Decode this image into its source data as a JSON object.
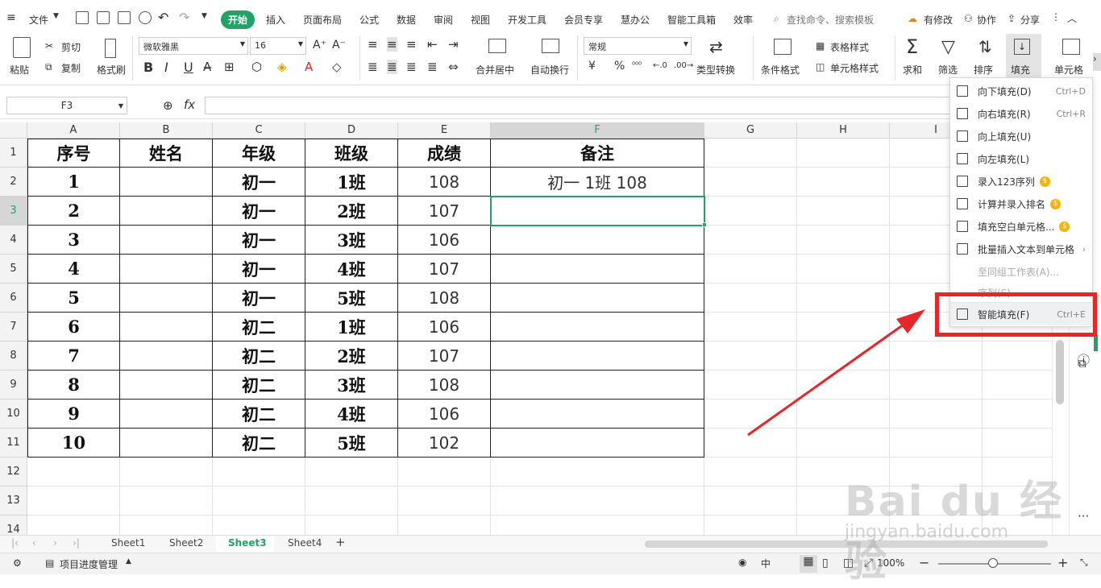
{
  "menu": {
    "file": "文件",
    "tabs": [
      "开始",
      "插入",
      "页面布局",
      "公式",
      "数据",
      "审阅",
      "视图",
      "开发工具",
      "会员专享",
      "慧办公",
      "智能工具箱",
      "效率"
    ],
    "search": "查找命令、搜索模板",
    "right": [
      "有修改",
      "协作",
      "分享"
    ]
  },
  "ribbon": {
    "paste": "粘贴",
    "cut": "剪切",
    "copy": "复制",
    "format_painter": "格式刷",
    "font": "微软雅黑",
    "font_size": "16",
    "bold": "B",
    "italic": "I",
    "underline": "U",
    "merge": "合并居中",
    "wrap": "自动换行",
    "number_format": "常规",
    "percent": "%",
    "type_convert": "类型转换",
    "cond_format": "条件格式",
    "table_style": "表格样式",
    "cell_style": "单元格样式",
    "sum": "求和",
    "filter": "筛选",
    "sort": "排序",
    "fill": "填充",
    "cell": "单元格"
  },
  "formula_bar": {
    "name_box": "F3",
    "fx": "fx"
  },
  "columns": [
    "A",
    "B",
    "C",
    "D",
    "E",
    "F",
    "G",
    "H",
    "I"
  ],
  "rows": [
    "1",
    "2",
    "3",
    "4",
    "5",
    "6",
    "7",
    "8",
    "9",
    "10",
    "11",
    "12",
    "13",
    "14"
  ],
  "table": {
    "headers": [
      "序号",
      "姓名",
      "年级",
      "班级",
      "成绩",
      "备注"
    ],
    "data": [
      [
        "1",
        "",
        "初一",
        "1班",
        "108",
        "初一  1班  108"
      ],
      [
        "2",
        "",
        "初一",
        "2班",
        "107",
        ""
      ],
      [
        "3",
        "",
        "初一",
        "3班",
        "106",
        ""
      ],
      [
        "4",
        "",
        "初一",
        "4班",
        "107",
        ""
      ],
      [
        "5",
        "",
        "初一",
        "5班",
        "108",
        ""
      ],
      [
        "6",
        "",
        "初二",
        "1班",
        "106",
        ""
      ],
      [
        "7",
        "",
        "初二",
        "2班",
        "107",
        ""
      ],
      [
        "8",
        "",
        "初二",
        "3班",
        "108",
        ""
      ],
      [
        "9",
        "",
        "初二",
        "4班",
        "106",
        ""
      ],
      [
        "10",
        "",
        "初二",
        "5班",
        "102",
        ""
      ]
    ]
  },
  "sheets": [
    "Sheet1",
    "Sheet2",
    "Sheet3",
    "Sheet4"
  ],
  "active_sheet": "Sheet3",
  "status": {
    "project": "项目进度管理",
    "zoom": "100%"
  },
  "fill_menu": [
    {
      "label": "向下填充(D)",
      "shortcut": "Ctrl+D"
    },
    {
      "label": "向右填充(R)",
      "shortcut": "Ctrl+R"
    },
    {
      "label": "向上填充(U)",
      "shortcut": ""
    },
    {
      "label": "向左填充(L)",
      "shortcut": ""
    },
    {
      "label": "录入123序列",
      "shortcut": ""
    },
    {
      "label": "计算并录入排名",
      "shortcut": ""
    },
    {
      "label": "填充空白单元格...",
      "shortcut": ""
    },
    {
      "label": "批量插入文本到单元格",
      "shortcut": ""
    },
    {
      "label": "至同组工作表(A)...",
      "shortcut": ""
    },
    {
      "label": "序列(S)...",
      "shortcut": ""
    },
    {
      "label": "智能填充(F)",
      "shortcut": "Ctrl+E"
    }
  ],
  "watermark": {
    "brand": "Bai du 经验",
    "url": "jingyan.baidu.com"
  },
  "colors": {
    "accent": "#21a366",
    "highlight": "#e6262a",
    "selection": "#21a366"
  }
}
